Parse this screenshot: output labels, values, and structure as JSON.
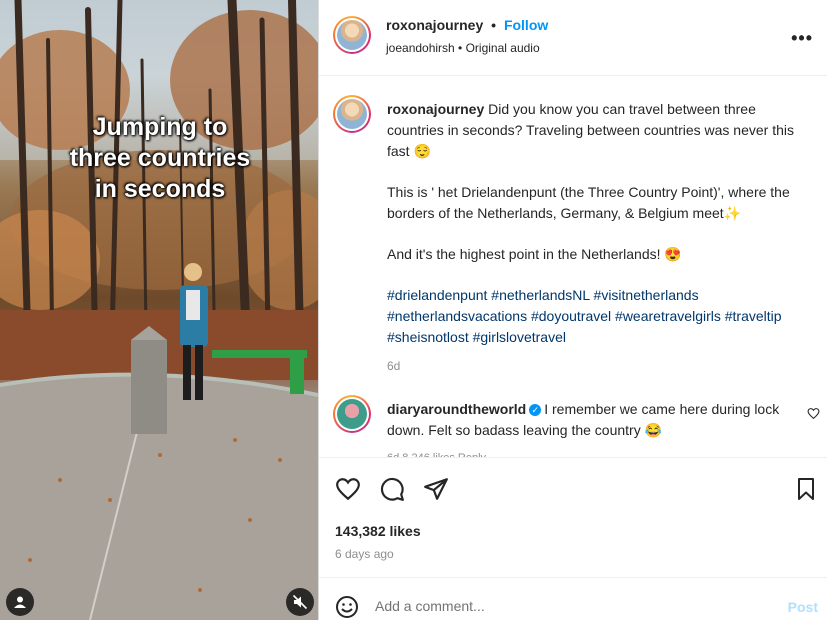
{
  "media": {
    "overlay_lines": [
      "Jumping to",
      "three countries",
      "in seconds"
    ]
  },
  "header": {
    "username": "roxonajourney",
    "dot": "•",
    "follow_label": "Follow",
    "subtitle": "joeandohirsh • Original audio",
    "more_label": "•••"
  },
  "caption": {
    "username": "roxonajourney",
    "para1": "Did you know you can travel between three countries in seconds? Traveling between countries was never this fast 😌",
    "para2": "This is ' het Drielandenpunt (the Three Country Point)', where the borders of the Netherlands, Germany, & Belgium meet✨",
    "para3": "And it's the highest point in the Netherlands! 😍",
    "hashtags": "#drielandenpunt #netherlandsNL #visitnetherlands #netherlandsvacations #doyoutravel #wearetravelgirls #traveltip #sheisnotlost #girlslovetravel",
    "time": "6d"
  },
  "comment": {
    "username": "diaryaroundtheworld",
    "verified_mark": "✓",
    "text": "I remember we came here during lock down. Felt so badass leaving the country 😂",
    "meta": "6d   8,246 likes   Reply"
  },
  "actions": {
    "likes": "143,382 likes",
    "ago": "6 days ago"
  },
  "add_comment": {
    "placeholder": "Add a comment...",
    "post_label": "Post"
  },
  "colors": {
    "accent": "#0095f6",
    "post_disabled": "#b2dffc",
    "hashtag": "#00376b"
  }
}
